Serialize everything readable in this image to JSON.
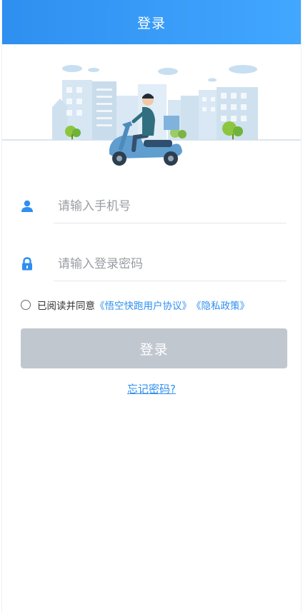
{
  "header": {
    "title": "登录"
  },
  "illustration": {
    "name": "city-scooter-illustration"
  },
  "form": {
    "phone_placeholder": "请输入手机号",
    "phone_value": "",
    "password_placeholder": "请输入登录密码",
    "password_value": ""
  },
  "agreement": {
    "checked": false,
    "prefix": "已阅读并同意",
    "user_agreement": "《悟空快跑用户协议》",
    "privacy_policy": "《隐私政策》"
  },
  "login_button": {
    "label": "登录",
    "enabled": false
  },
  "forgot_password": {
    "label": "忘记密码?"
  },
  "colors": {
    "primary": "#2f8ff0",
    "header_gradient_end": "#41a7ff",
    "button_disabled": "#c1c7cf",
    "placeholder": "#9a9da3"
  }
}
